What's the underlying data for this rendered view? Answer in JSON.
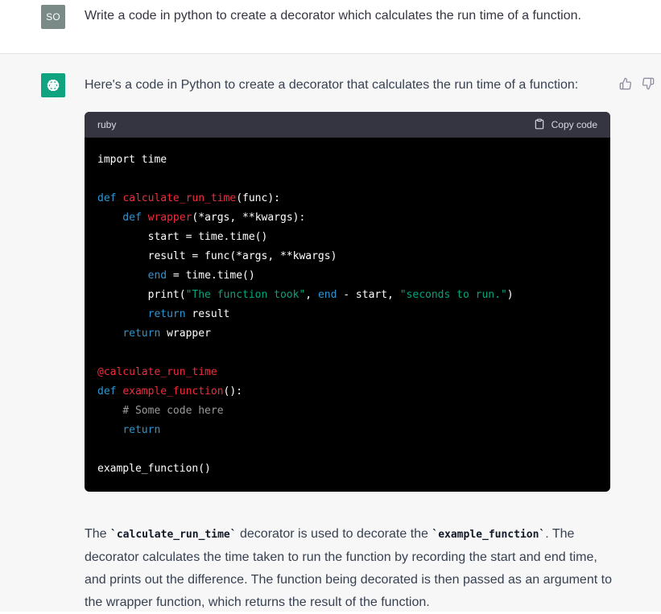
{
  "user": {
    "avatar_initials": "SO",
    "message": "Write a code in python to create a decorator which calculates the run time of a function."
  },
  "assistant": {
    "intro": "Here's a code in Python to create a decorator that calculates the run time of a function:",
    "code_block": {
      "language": "ruby",
      "copy_label": "Copy code",
      "lines": [
        [
          {
            "t": "import time",
            "c": "plain"
          }
        ],
        [],
        [
          {
            "t": "def ",
            "c": "kw"
          },
          {
            "t": "calculate_run_time",
            "c": "fn"
          },
          {
            "t": "(func):",
            "c": "plain"
          }
        ],
        [
          {
            "t": "    def ",
            "c": "kw"
          },
          {
            "t": "wrapper",
            "c": "fn"
          },
          {
            "t": "(*args, **kwargs):",
            "c": "plain"
          }
        ],
        [
          {
            "t": "        start = time.time()",
            "c": "plain"
          }
        ],
        [
          {
            "t": "        result = func(*args, **kwargs)",
            "c": "plain"
          }
        ],
        [
          {
            "t": "        ",
            "c": "plain"
          },
          {
            "t": "end",
            "c": "kw"
          },
          {
            "t": " = time.time()",
            "c": "plain"
          }
        ],
        [
          {
            "t": "        print(",
            "c": "plain"
          },
          {
            "t": "\"The function took\"",
            "c": "str"
          },
          {
            "t": ", ",
            "c": "plain"
          },
          {
            "t": "end",
            "c": "kw"
          },
          {
            "t": " - start, ",
            "c": "plain"
          },
          {
            "t": "\"seconds to run.\"",
            "c": "str"
          },
          {
            "t": ")",
            "c": "plain"
          }
        ],
        [
          {
            "t": "        ",
            "c": "plain"
          },
          {
            "t": "return",
            "c": "kw"
          },
          {
            "t": " result",
            "c": "plain"
          }
        ],
        [
          {
            "t": "    ",
            "c": "plain"
          },
          {
            "t": "return",
            "c": "kw"
          },
          {
            "t": " wrapper",
            "c": "plain"
          }
        ],
        [],
        [
          {
            "t": "@calculate_run_time",
            "c": "dec"
          }
        ],
        [
          {
            "t": "def ",
            "c": "kw"
          },
          {
            "t": "example_function",
            "c": "fn"
          },
          {
            "t": "():",
            "c": "plain"
          }
        ],
        [
          {
            "t": "    # Some code here",
            "c": "com"
          }
        ],
        [
          {
            "t": "    ",
            "c": "plain"
          },
          {
            "t": "return",
            "c": "kw"
          }
        ],
        [],
        [
          {
            "t": "example_function()",
            "c": "plain"
          }
        ]
      ]
    },
    "explanation": {
      "p1_prefix": "The ",
      "code1": "`calculate_run_time`",
      "p1_mid": " decorator is used to decorate the ",
      "code2": "`example_function`",
      "p1_suffix": ". The decorator calculates the time taken to run the function by recording the start and end time, and prints out the difference. The function being decorated is then passed as an argument to the wrapper function, which returns the result of the function."
    }
  },
  "icons": {
    "assistant_avatar": "openai-logo-icon",
    "thumbs_up": "thumbs-up-icon",
    "thumbs_down": "thumbs-down-icon",
    "clipboard": "clipboard-icon"
  },
  "colors": {
    "assistant_avatar_bg": "#10a37f",
    "user_avatar_bg": "#7a8a86",
    "code_bg": "#000000",
    "code_header_bg": "#343541",
    "keyword": "#2e95d3",
    "function_name": "#f22c3d",
    "string": "#00a67d",
    "comment": "#9a9a9a"
  }
}
